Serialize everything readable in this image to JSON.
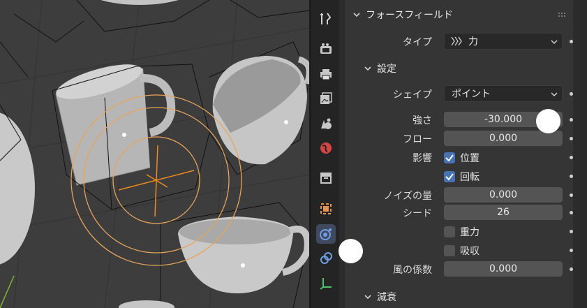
{
  "panel": {
    "section_title": "フォースフィールド",
    "type": {
      "label": "タイプ",
      "value": "力"
    },
    "settings": {
      "title": "設定",
      "shape": {
        "label": "シェイプ",
        "value": "ポイント"
      },
      "strength": {
        "label": "強さ",
        "value": "-30.000"
      },
      "flow": {
        "label": "フロー",
        "value": "0.000"
      },
      "affect": {
        "label": "影響",
        "location": {
          "label": "位置",
          "checked": true
        },
        "rotation": {
          "label": "回転",
          "checked": true
        }
      },
      "noise": {
        "label": "ノイズの量",
        "value": "0.000"
      },
      "seed": {
        "label": "シード",
        "value": "26"
      },
      "gravity": {
        "label": "重力",
        "checked": false
      },
      "absorption": {
        "label": "吸収",
        "checked": false
      },
      "wind_factor": {
        "label": "風の係数",
        "value": "0.000"
      }
    },
    "falloff_title": "減衰"
  },
  "tabs": [
    {
      "name": "tool-icon"
    },
    {
      "name": "render-icon"
    },
    {
      "name": "output-icon"
    },
    {
      "name": "view-layer-icon"
    },
    {
      "name": "scene-icon"
    },
    {
      "name": "world-icon"
    },
    {
      "name": "collection-icon"
    },
    {
      "name": "object-icon"
    },
    {
      "name": "physics-icon",
      "active": true
    },
    {
      "name": "constraints-icon"
    },
    {
      "name": "object-data-icon"
    }
  ],
  "colors": {
    "accent": "#4772b3",
    "field": "#545454",
    "panel": "#353535",
    "force_field": "#e8a45a"
  }
}
